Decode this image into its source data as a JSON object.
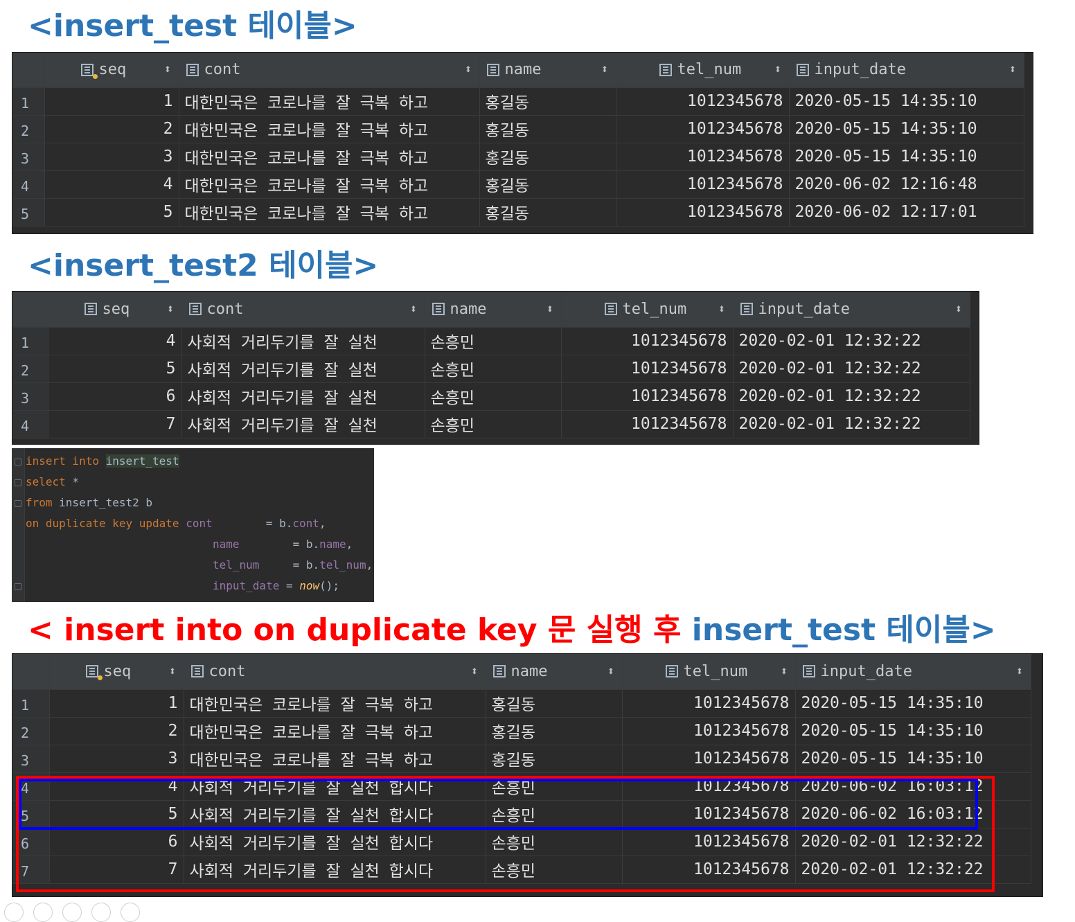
{
  "headings": {
    "h1": "<insert_test 테이블>",
    "h2": "<insert_test2 테이블>",
    "h3_red": "< insert into on duplicate key 문 실행 후",
    "h3_blue": " insert_test 테이블>"
  },
  "columns": {
    "seq": "seq",
    "cont": "cont",
    "name": "name",
    "tel_num": "tel_num",
    "input_date": "input_date",
    "sort_symbol": "⬍"
  },
  "table1": {
    "rows": [
      {
        "n": "1",
        "seq": "1",
        "cont": "대한민국은 코로나를 잘 극복 하고",
        "name": "홍길동",
        "tel": "1012345678",
        "date": "2020-05-15 14:35:10"
      },
      {
        "n": "2",
        "seq": "2",
        "cont": "대한민국은 코로나를 잘 극복 하고",
        "name": "홍길동",
        "tel": "1012345678",
        "date": "2020-05-15 14:35:10"
      },
      {
        "n": "3",
        "seq": "3",
        "cont": "대한민국은 코로나를 잘 극복 하고",
        "name": "홍길동",
        "tel": "1012345678",
        "date": "2020-05-15 14:35:10"
      },
      {
        "n": "4",
        "seq": "4",
        "cont": "대한민국은 코로나를 잘 극복 하고",
        "name": "홍길동",
        "tel": "1012345678",
        "date": "2020-06-02 12:16:48"
      },
      {
        "n": "5",
        "seq": "5",
        "cont": "대한민국은 코로나를 잘 극복 하고",
        "name": "홍길동",
        "tel": "1012345678",
        "date": "2020-06-02 12:17:01"
      }
    ]
  },
  "table2": {
    "rows": [
      {
        "n": "1",
        "seq": "4",
        "cont": "사회적 거리두기를 잘 실천",
        "name": "손흥민",
        "tel": "1012345678",
        "date": "2020-02-01 12:32:22"
      },
      {
        "n": "2",
        "seq": "5",
        "cont": "사회적 거리두기를 잘 실천",
        "name": "손흥민",
        "tel": "1012345678",
        "date": "2020-02-01 12:32:22"
      },
      {
        "n": "3",
        "seq": "6",
        "cont": "사회적 거리두기를 잘 실천",
        "name": "손흥민",
        "tel": "1012345678",
        "date": "2020-02-01 12:32:22"
      },
      {
        "n": "4",
        "seq": "7",
        "cont": "사회적 거리두기를 잘 실천",
        "name": "손흥민",
        "tel": "1012345678",
        "date": "2020-02-01 12:32:22"
      }
    ]
  },
  "code": {
    "l1_kw": "insert into",
    "l1_tbl": "insert_test",
    "l2_kw": "select",
    "l2_rest": " *",
    "l3_kw": "from",
    "l3_rest": " insert_test2 b",
    "l4_kw": "on duplicate key update",
    "c_cont": "cont",
    "c_name": "name",
    "c_tel": "tel_num",
    "c_date": "input_date",
    "eq_cont": "        = b.",
    "v_cont": "cont",
    "eq_name": "        = b.",
    "v_name": "name",
    "eq_tel": "     = b.",
    "v_tel": "tel_num",
    "eq_date": " = ",
    "fn_now": "now",
    "tail_now": "();",
    "comma": ","
  },
  "table3": {
    "rows": [
      {
        "n": "1",
        "seq": "1",
        "cont": "대한민국은 코로나를 잘 극복 하고",
        "name": "홍길동",
        "tel": "1012345678",
        "date": "2020-05-15 14:35:10"
      },
      {
        "n": "2",
        "seq": "2",
        "cont": "대한민국은 코로나를 잘 극복 하고",
        "name": "홍길동",
        "tel": "1012345678",
        "date": "2020-05-15 14:35:10"
      },
      {
        "n": "3",
        "seq": "3",
        "cont": "대한민국은 코로나를 잘 극복 하고",
        "name": "홍길동",
        "tel": "1012345678",
        "date": "2020-05-15 14:35:10"
      },
      {
        "n": "4",
        "seq": "4",
        "cont": "사회적 거리두기를 잘 실천 합시다",
        "name": "손흥민",
        "tel": "1012345678",
        "date": "2020-06-02 16:03:12"
      },
      {
        "n": "5",
        "seq": "5",
        "cont": "사회적 거리두기를 잘 실천 합시다",
        "name": "손흥민",
        "tel": "1012345678",
        "date": "2020-06-02 16:03:12"
      },
      {
        "n": "6",
        "seq": "6",
        "cont": "사회적 거리두기를 잘 실천 합시다",
        "name": "손흥민",
        "tel": "1012345678",
        "date": "2020-02-01 12:32:22"
      },
      {
        "n": "7",
        "seq": "7",
        "cont": "사회적 거리두기를 잘 실천 합시다",
        "name": "손흥민",
        "tel": "1012345678",
        "date": "2020-02-01 12:32:22"
      }
    ]
  },
  "colors": {
    "heading_blue": "#2e75b6",
    "heading_red": "#ff0000",
    "highlight_red_box": "#ff0000",
    "highlight_blue_box": "#0000ff",
    "grid_bg": "#2b2b2b"
  }
}
